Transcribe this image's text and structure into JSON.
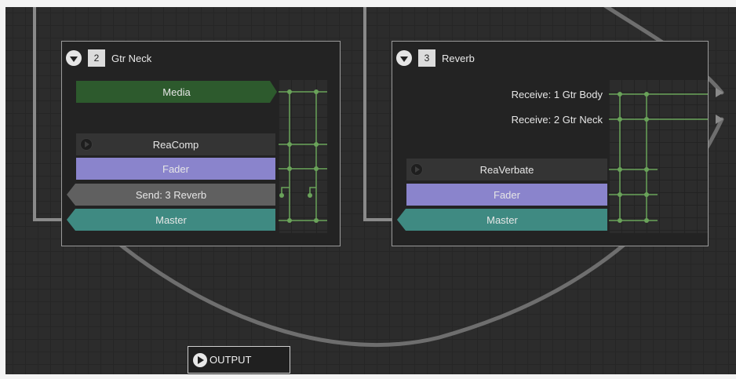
{
  "colors": {
    "canvas": "#2c2c2c",
    "node_bg": "#232323",
    "node_border": "#9a9a9a",
    "media": "#2d5a2d",
    "fader": "#8a84cc",
    "send": "#606060",
    "master": "#3f8a82",
    "pin": "#6aa35a",
    "wire": "#8a8a8a"
  },
  "tracks": [
    {
      "number": "2",
      "name": "Gtr Neck",
      "rows": {
        "media": "Media",
        "fx1": "ReaComp",
        "fader": "Fader",
        "send": "Send: 3 Reverb",
        "master": "Master"
      }
    },
    {
      "number": "3",
      "name": "Reverb",
      "rows": {
        "receive1": "Receive: 1 Gtr Body",
        "receive2": "Receive: 2 Gtr Neck",
        "fx1": "ReaVerbate",
        "fader": "Fader",
        "master": "Master"
      }
    }
  ],
  "output": {
    "label": "OUTPUT",
    "icon": "play-circle-icon"
  }
}
